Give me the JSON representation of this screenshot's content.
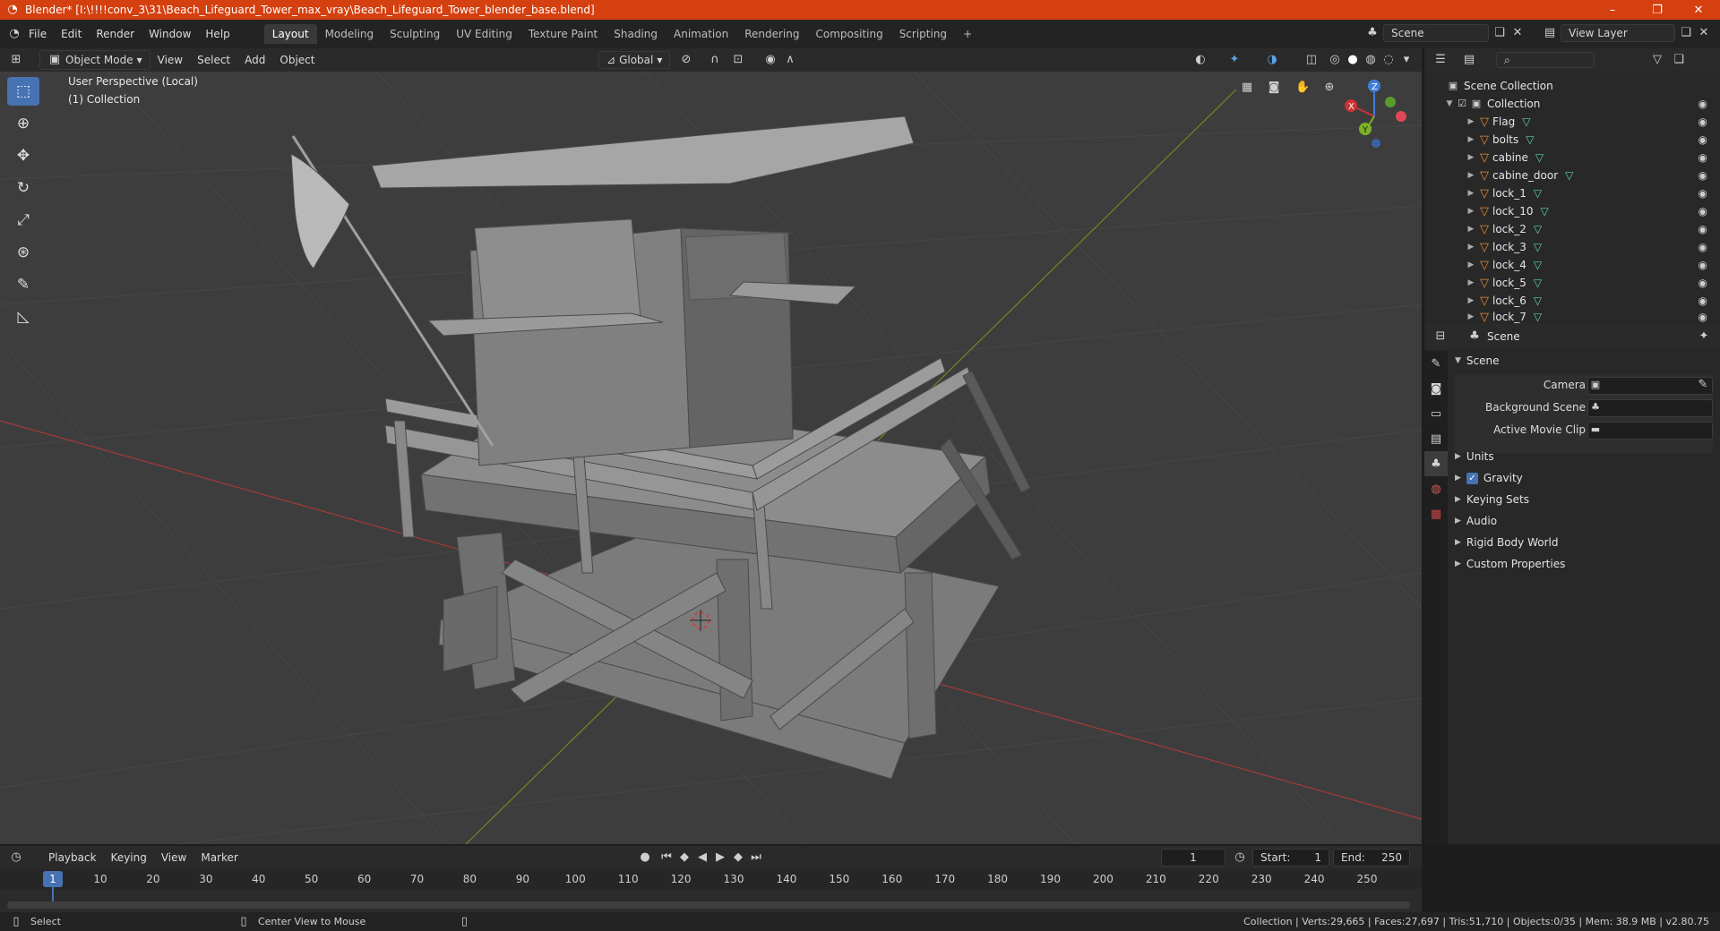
{
  "window": {
    "title": "Blender* [I:\\!!!!conv_3\\31\\Beach_Lifeguard_Tower_max_vray\\Beach_Lifeguard_Tower_blender_base.blend]",
    "minimize": "–",
    "maximize": "❐",
    "close": "✕"
  },
  "menu": {
    "items": [
      "File",
      "Edit",
      "Render",
      "Window",
      "Help"
    ],
    "workspaces": [
      "Layout",
      "Modeling",
      "Sculpting",
      "UV Editing",
      "Texture Paint",
      "Shading",
      "Animation",
      "Rendering",
      "Compositing",
      "Scripting"
    ],
    "add_workspace": "+",
    "scene_name": "Scene",
    "view_layer": "View Layer"
  },
  "viewport_header": {
    "mode": "Object Mode",
    "items": [
      "View",
      "Select",
      "Add",
      "Object"
    ],
    "transform_orientation": "Global"
  },
  "viewport": {
    "perspective_label": "User Perspective (Local)",
    "collection_label": "(1) Collection",
    "gizmo": {
      "x": "X",
      "y": "Y",
      "z": "Z"
    }
  },
  "outliner": {
    "root": "Scene Collection",
    "collection": "Collection",
    "objects": [
      "Flag",
      "bolts",
      "cabine",
      "cabine_door",
      "lock_1",
      "lock_10",
      "lock_2",
      "lock_3",
      "lock_4",
      "lock_5",
      "lock_6",
      "lock_7"
    ]
  },
  "properties": {
    "context": "Scene",
    "section_title": "Scene",
    "fields": [
      {
        "label": "Camera",
        "value": ""
      },
      {
        "label": "Background Scene",
        "value": ""
      },
      {
        "label": "Active Movie Clip",
        "value": ""
      }
    ],
    "panels": [
      "Units",
      "Gravity",
      "Keying Sets",
      "Audio",
      "Rigid Body World",
      "Custom Properties"
    ],
    "gravity_checked": true
  },
  "timeline": {
    "menus": [
      "Playback",
      "Keying",
      "View",
      "Marker"
    ],
    "current_frame": "1",
    "start_label": "Start:",
    "start": "1",
    "end_label": "End:",
    "end": "250",
    "ticks": [
      "1",
      "10",
      "20",
      "30",
      "40",
      "50",
      "60",
      "70",
      "80",
      "90",
      "100",
      "110",
      "120",
      "130",
      "140",
      "150",
      "160",
      "170",
      "180",
      "190",
      "200",
      "210",
      "220",
      "230",
      "240",
      "250"
    ]
  },
  "status": {
    "select": "Select",
    "center_view": "Center View to Mouse",
    "stats": "Collection | Verts:29,665 | Faces:27,697 | Tris:51,710 | Objects:0/35 | Mem: 38.9 MB | v2.80.75"
  }
}
